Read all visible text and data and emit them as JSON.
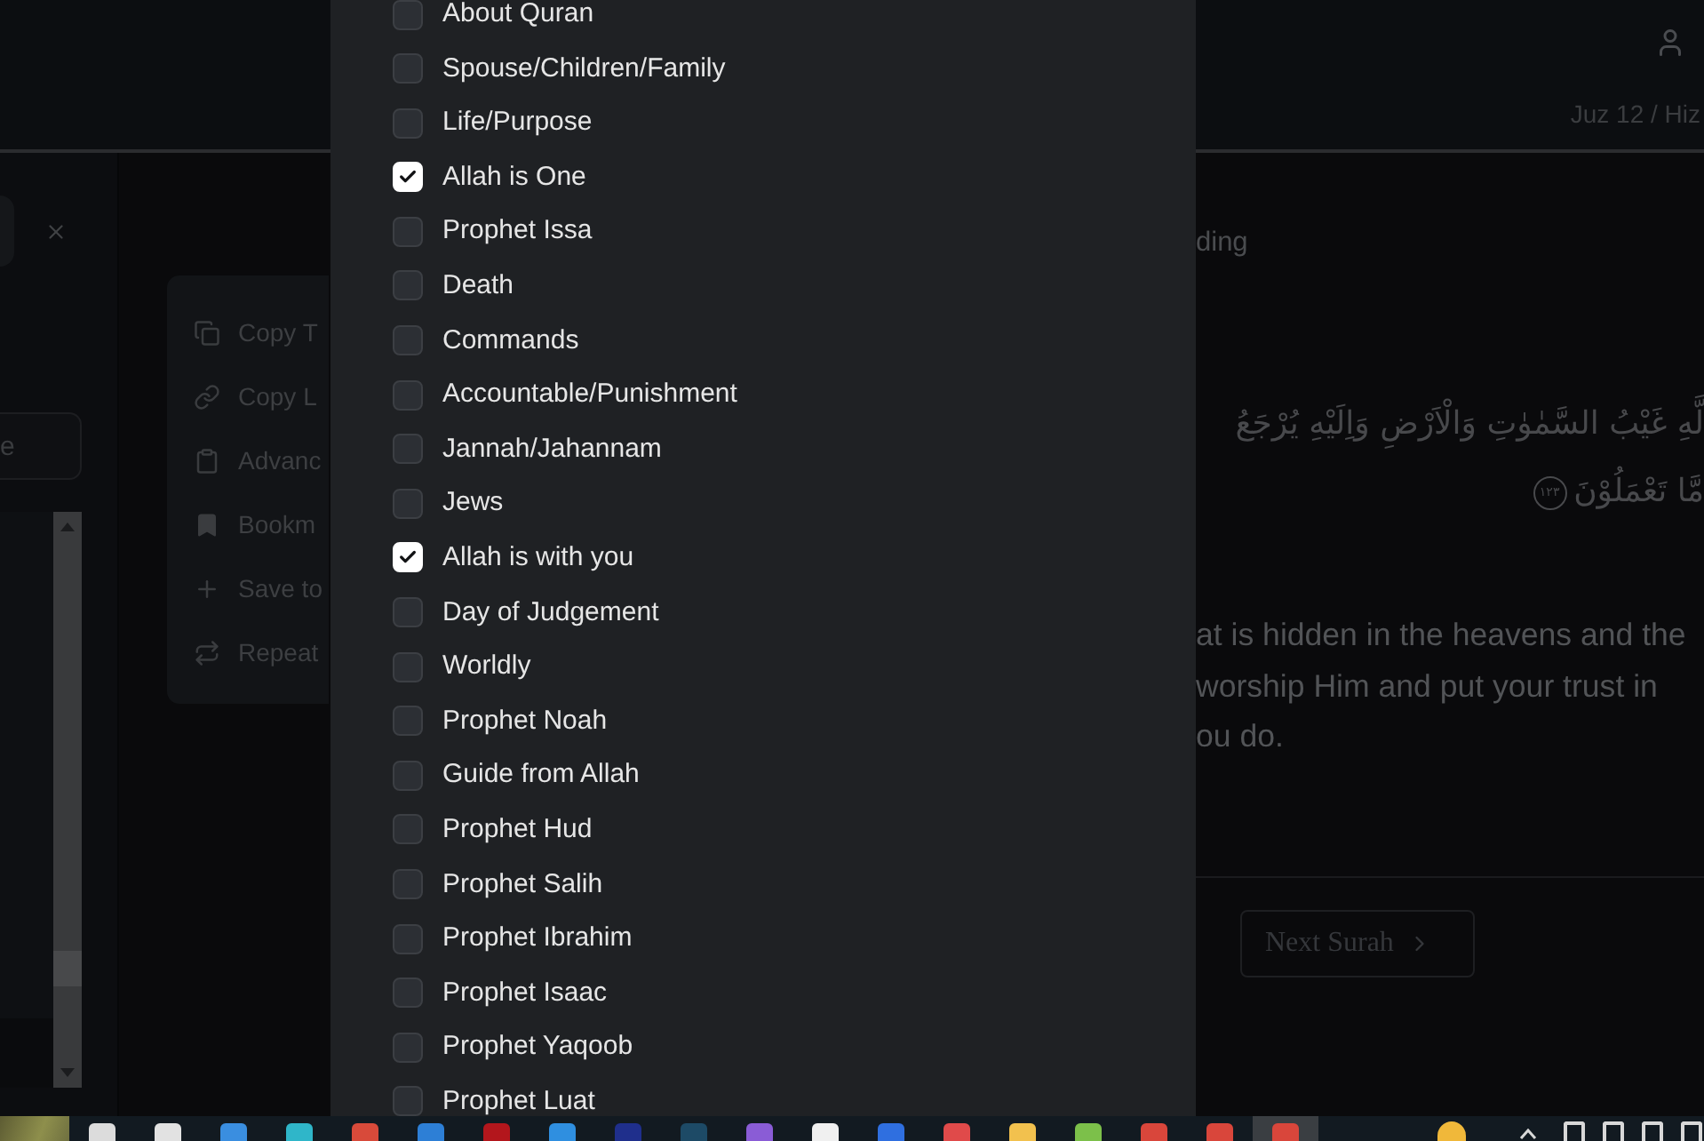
{
  "header": {
    "juz_label": "Juz 12 / Hiz"
  },
  "side_panel": {
    "button_label": "e"
  },
  "context_menu": {
    "items": [
      "Copy T",
      "Copy L",
      "Advanc",
      "Bookm",
      "Save to",
      "Repeat"
    ]
  },
  "reading": {
    "tab_label": "ding",
    "arabic_lines": [
      "لَّهِ غَيْبُ السَّمٰوٰتِ وَالْاَرْضِ وَاِلَيْهِ يُرْجَعُ",
      "مَّا تَعْمَلُوْنَ"
    ],
    "verse_number": "١٢٣",
    "translation_lines": [
      "at is hidden in the heavens and the",
      "worship Him and put your trust in",
      "ou do."
    ],
    "next_button": "Next Surah"
  },
  "topic_dialog": {
    "topics": [
      {
        "label": "About Quran",
        "checked": false
      },
      {
        "label": "Spouse/Children/Family",
        "checked": false
      },
      {
        "label": "Life/Purpose",
        "checked": false
      },
      {
        "label": "Allah is One",
        "checked": true
      },
      {
        "label": "Prophet Issa",
        "checked": false
      },
      {
        "label": "Death",
        "checked": false
      },
      {
        "label": "Commands",
        "checked": false
      },
      {
        "label": "Accountable/Punishment",
        "checked": false
      },
      {
        "label": "Jannah/Jahannam",
        "checked": false
      },
      {
        "label": "Jews",
        "checked": false
      },
      {
        "label": "Allah is with you",
        "checked": true
      },
      {
        "label": "Day of Judgement",
        "checked": false
      },
      {
        "label": "Worldly",
        "checked": false
      },
      {
        "label": "Prophet Noah",
        "checked": false
      },
      {
        "label": "Guide from Allah",
        "checked": false
      },
      {
        "label": "Prophet Hud",
        "checked": false
      },
      {
        "label": "Prophet Salih",
        "checked": false
      },
      {
        "label": "Prophet Ibrahim",
        "checked": false
      },
      {
        "label": "Prophet Isaac",
        "checked": false
      },
      {
        "label": "Prophet Yaqoob",
        "checked": false
      },
      {
        "label": "Prophet Luat",
        "checked": false
      }
    ]
  },
  "taskbar": {
    "apps": [
      {
        "color": "#dcdcdc",
        "selected": false
      },
      {
        "color": "#e2e2e2",
        "selected": false
      },
      {
        "color": "#3a8ee0",
        "selected": false
      },
      {
        "color": "#2fb6c9",
        "selected": false
      },
      {
        "color": "#d84a3a",
        "selected": false
      },
      {
        "color": "#2d7fd6",
        "selected": false
      },
      {
        "color": "#b3161c",
        "selected": false
      },
      {
        "color": "#2f8fe0",
        "selected": false
      },
      {
        "color": "#1f2f8c",
        "selected": false
      },
      {
        "color": "#1d4a66",
        "selected": false
      },
      {
        "color": "#8a5cd6",
        "selected": false
      },
      {
        "color": "#f0f0f0",
        "selected": false
      },
      {
        "color": "#2f6fe0",
        "selected": false
      },
      {
        "color": "#e04a4a",
        "selected": false
      },
      {
        "color": "#f2c14e",
        "selected": false
      },
      {
        "color": "#7cc04a",
        "selected": false
      },
      {
        "color": "#d9463b",
        "selected": false
      },
      {
        "color": "#d9463b",
        "selected": false
      },
      {
        "color": "#d9463b",
        "selected": true
      }
    ]
  }
}
